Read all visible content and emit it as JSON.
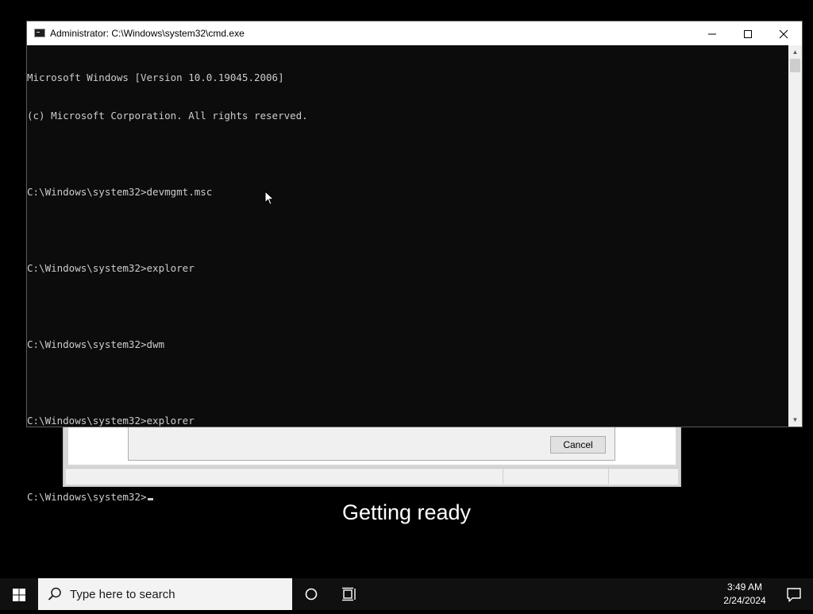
{
  "background_dialog": {
    "cancel_label": "Cancel",
    "status_text": "Getting ready"
  },
  "cmd": {
    "title": "Administrator: C:\\Windows\\system32\\cmd.exe",
    "lines": [
      "Microsoft Windows [Version 10.0.19045.2006]",
      "(c) Microsoft Corporation. All rights reserved.",
      "",
      "C:\\Windows\\system32>devmgmt.msc",
      "",
      "C:\\Windows\\system32>explorer",
      "",
      "C:\\Windows\\system32>dwm",
      "",
      "C:\\Windows\\system32>explorer",
      ""
    ],
    "prompt": "C:\\Windows\\system32>",
    "window_buttons": {
      "minimize": "—",
      "maximize": "☐",
      "close": "✕"
    }
  },
  "taskbar": {
    "search_placeholder": "Type here to search",
    "time": "3:49 AM",
    "date": "2/24/2024",
    "icons": [
      "windows-start-icon",
      "search-icon",
      "cortana-icon",
      "task-view-icon",
      "notification-icon"
    ]
  }
}
